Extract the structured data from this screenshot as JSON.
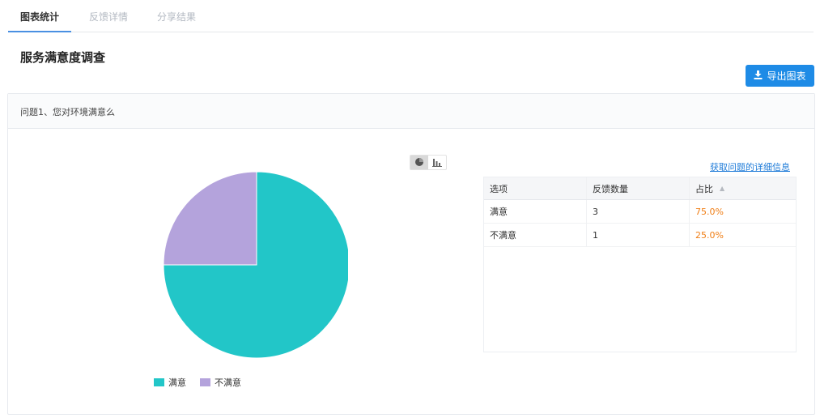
{
  "tabs": [
    {
      "label": "图表统计",
      "active": true
    },
    {
      "label": "反馈详情",
      "active": false
    },
    {
      "label": "分享结果",
      "active": false
    }
  ],
  "page_title": "服务满意度调查",
  "export_button": {
    "label": "导出图表",
    "icon": "download-icon"
  },
  "question": {
    "title": "问题1、您对环境满意么",
    "detail_link": "获取问题的详细信息",
    "chart_toggle": [
      {
        "icon": "pie-chart-icon",
        "active": true
      },
      {
        "icon": "bar-chart-icon",
        "active": false
      }
    ],
    "table": {
      "headers": [
        "选项",
        "反馈数量",
        "占比"
      ],
      "rows": [
        {
          "option": "满意",
          "count": "3",
          "percent": "75.0%"
        },
        {
          "option": "不满意",
          "count": "1",
          "percent": "25.0%"
        }
      ]
    }
  },
  "colors": {
    "accent": "#1e8be6",
    "satisfied": "#22c6c8",
    "unsatisfied": "#b4a3dc",
    "percent_text": "#f07f17"
  },
  "chart_data": {
    "type": "pie",
    "categories": [
      "满意",
      "不满意"
    ],
    "values": [
      3,
      1
    ],
    "legend": "bottom-left"
  }
}
